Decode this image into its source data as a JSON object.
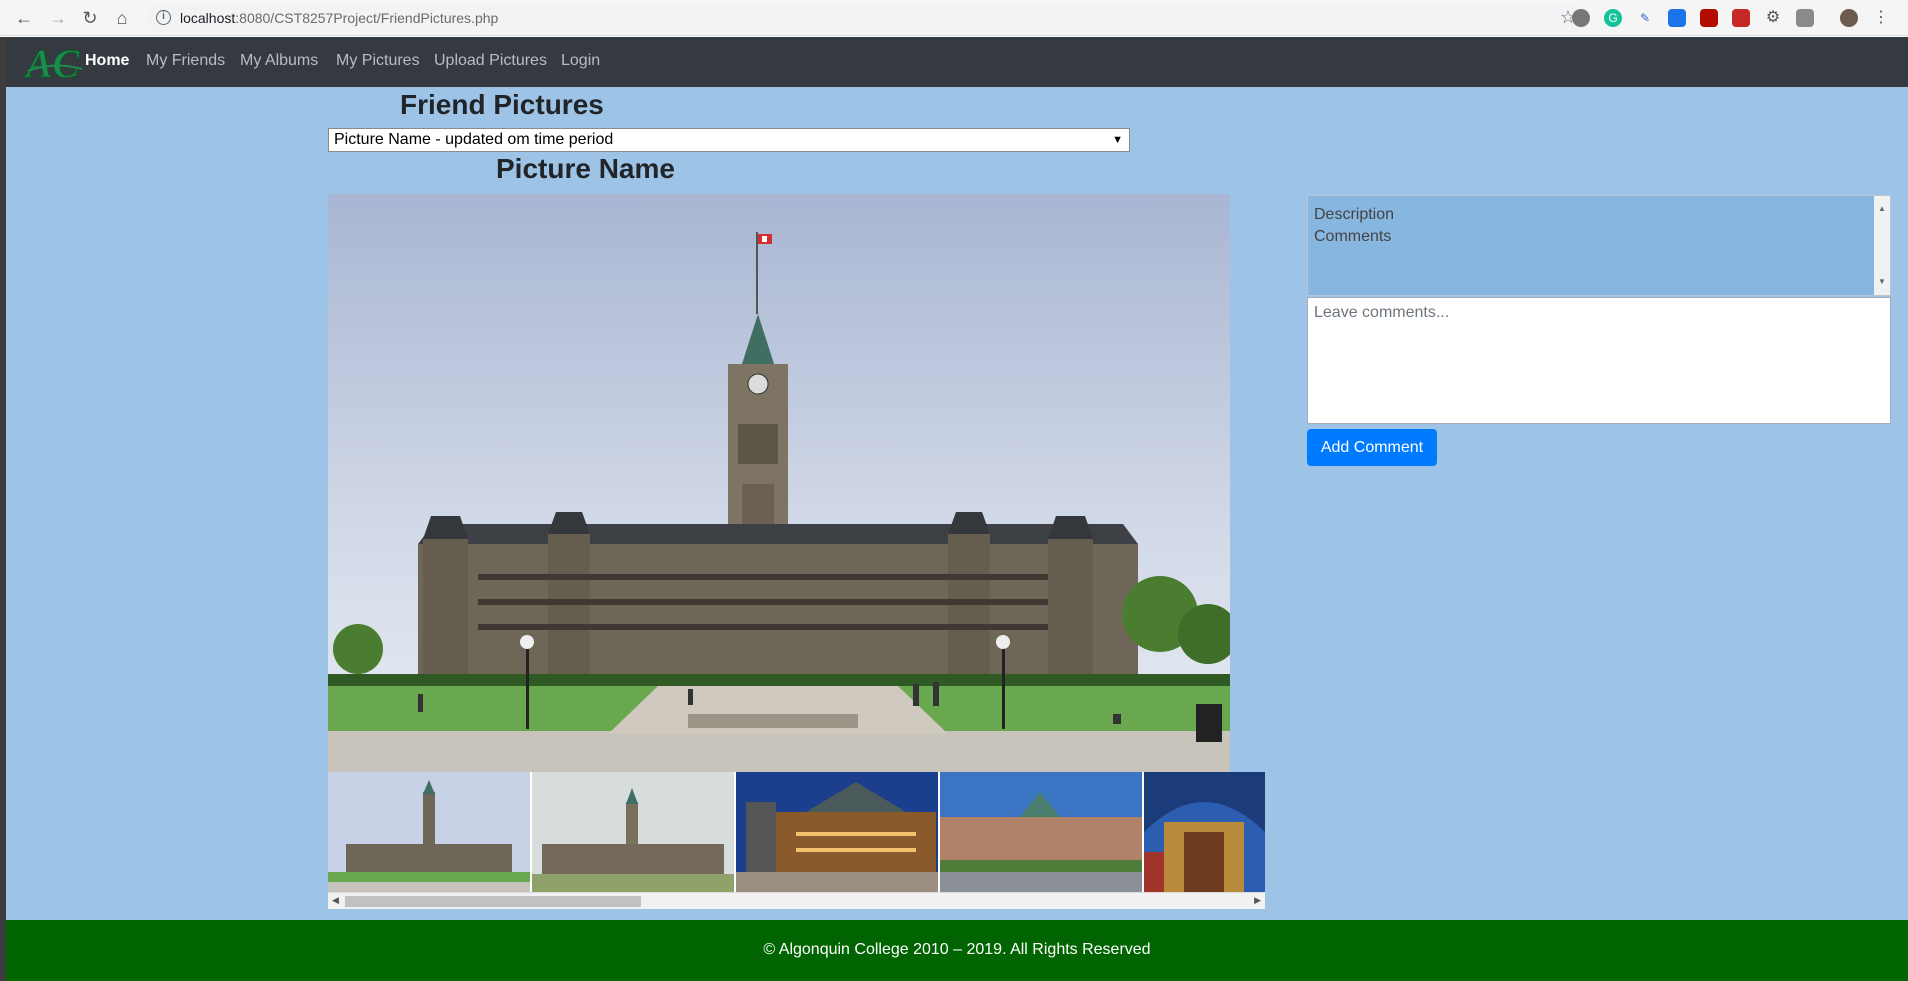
{
  "browser": {
    "url_host": "localhost",
    "url_path": ":8080/CST8257Project/FriendPictures.php"
  },
  "navbar": {
    "logo_alt": "AC",
    "links": [
      "Home",
      "My Friends",
      "My Albums",
      "My Pictures",
      "Upload Pictures",
      "Login"
    ]
  },
  "main": {
    "title": "Friend Pictures",
    "picture_select": "Picture Name - updated om time period",
    "picture_name": "Picture Name"
  },
  "sidebar": {
    "description": "Description",
    "comments": "Comments",
    "comment_placeholder": "Leave comments...",
    "add_comment_label": "Add Comment"
  },
  "footer": {
    "text": "© Algonquin College 2010 – 2019. All Rights Reserved"
  },
  "colors": {
    "page_bg": "#9dc3e6",
    "navbar_bg": "#343a40",
    "footer_bg": "#006400",
    "button_bg": "#007bff"
  }
}
